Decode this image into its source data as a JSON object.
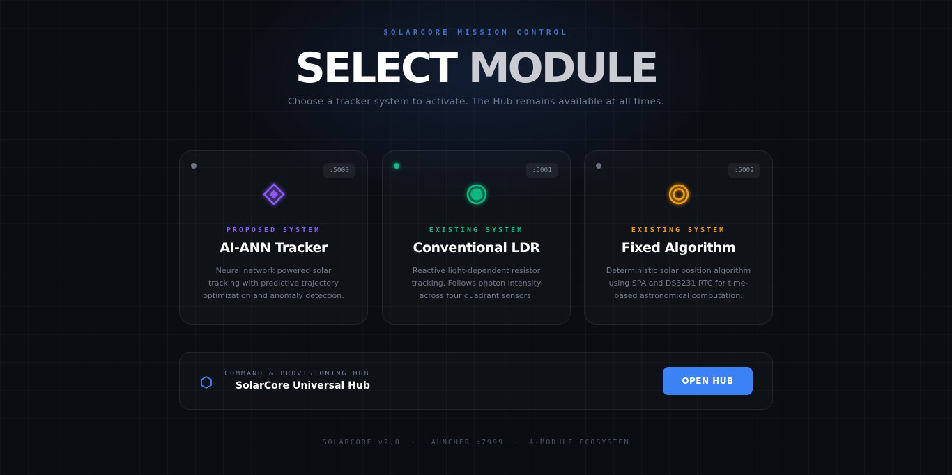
{
  "header": {
    "kicker": "SOLARCORE MISSION CONTROL",
    "title_word1": "SELECT",
    "title_word2": "MODULE",
    "subtitle": "Choose a tracker system to activate. The Hub remains available at all times."
  },
  "modules": [
    {
      "port": ":5000",
      "tag": "PROPOSED SYSTEM",
      "name": "AI-ANN Tracker",
      "description": "Neural network powered solar tracking with predictive trajectory optimization and anomaly detection.",
      "accent_color": "#8b5cf6",
      "status_color": "#6b7280",
      "icon": "diamond-icon"
    },
    {
      "port": ":5001",
      "tag": "EXISTING SYSTEM",
      "name": "Conventional LDR",
      "description": "Reactive light-dependent resistor tracking. Follows photon intensity across four quadrant sensors.",
      "accent_color": "#10b981",
      "status_color": "#10b981",
      "icon": "record-icon"
    },
    {
      "port": ":5002",
      "tag": "EXISTING SYSTEM",
      "name": "Fixed Algorithm",
      "description": "Deterministic solar position algorithm using SPA and DS3231 RTC for time-based astronomical computation.",
      "accent_color": "#f59e0b",
      "status_color": "#6b7280",
      "icon": "target-icon"
    }
  ],
  "hub": {
    "kicker": "COMMAND & PROVISIONING HUB",
    "name": "SolarCore Universal Hub",
    "button_label": "OPEN HUB",
    "icon": "hexagon-icon",
    "accent_color": "#3b82f6"
  },
  "footer": {
    "version": "SOLARCORE v2.0",
    "launcher": "LAUNCHER :7999",
    "ecosystem": "4-MODULE ECOSYSTEM",
    "separator": "·"
  }
}
